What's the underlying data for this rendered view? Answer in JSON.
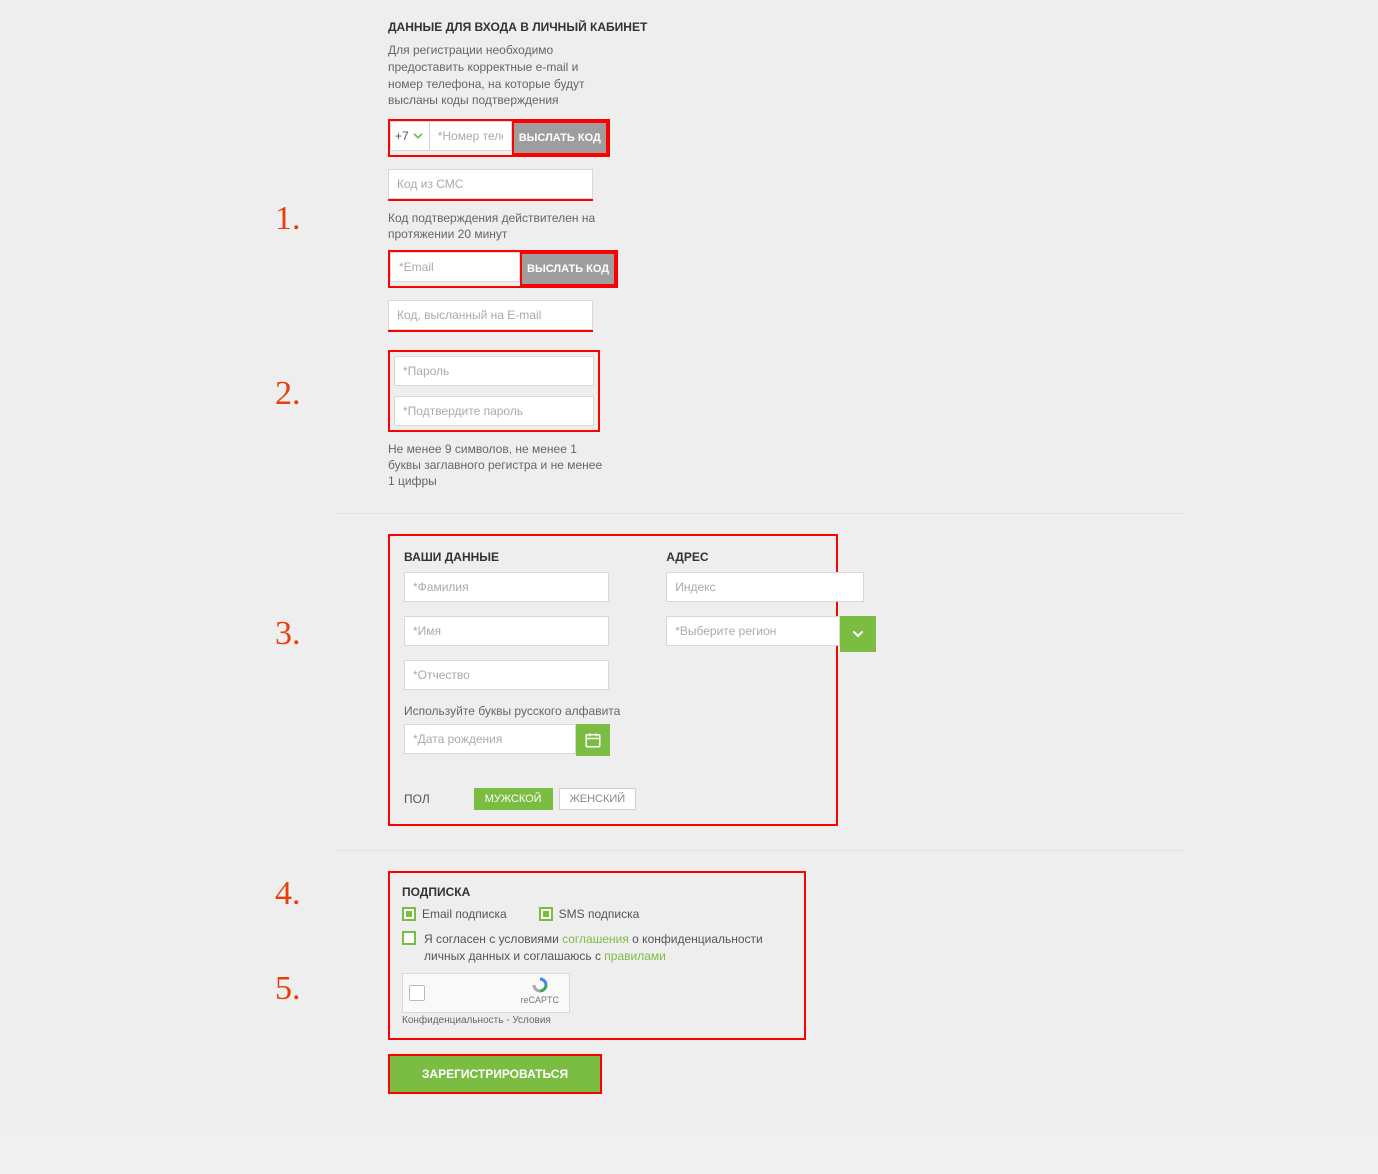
{
  "annotations": {
    "a1": "1.",
    "a2": "2.",
    "a3": "3.",
    "a4": "4.",
    "a5": "5."
  },
  "section1": {
    "title": "ДАННЫЕ ДЛЯ ВХОДА В ЛИЧНЫЙ КАБИНЕТ",
    "intro": "Для регистрации необходимо предоставить корректные e-mail и номер телефона, на которые будут высланы коды подтверждения",
    "cc": "+7",
    "phone_ph": "*Номер телеф",
    "send_btn": "ВЫСЛАТЬ КОД",
    "sms_code_ph": "Код из СМС",
    "code_hint": "Код подтверждения действителен на протяжении 20 минут",
    "email_ph": "*Email",
    "send_btn2": "ВЫСЛАТЬ КОД",
    "email_code_ph": "Код, высланный на E-mail"
  },
  "section2": {
    "password_ph": "*Пароль",
    "confirm_ph": "*Подтвердите пароль",
    "hint": "Не менее 9 символов, не менее 1 буквы заглавного регистра и не менее 1 цифры"
  },
  "section3": {
    "title_data": "ВАШИ ДАННЫЕ",
    "title_addr": "АДРЕС",
    "surname_ph": "*Фамилия",
    "name_ph": "*Имя",
    "patronymic_ph": "*Отчество",
    "alpha_hint": "Используйте буквы русского алфавита",
    "dob_ph": "*Дата рождения",
    "gender_label": "ПОЛ",
    "male": "МУЖСКОЙ",
    "female": "ЖЕНСКИЙ",
    "index_ph": "Индекс",
    "region_ph": "*Выберите регион"
  },
  "section4": {
    "title": "ПОДПИСКА",
    "email_sub": "Email подписка",
    "sms_sub": "SMS подписка",
    "agree1": "Я согласен с условиями ",
    "agree_link1": "соглашения",
    "agree2": " о конфиденциальности личных данных и соглашаюсь с ",
    "agree_link2": "правилами",
    "recaptcha": "reCAPTC",
    "rc_legal": "Конфиденциальность - Условия"
  },
  "register": {
    "button": "ЗАРЕГИСТРИРОВАТЬСЯ"
  }
}
